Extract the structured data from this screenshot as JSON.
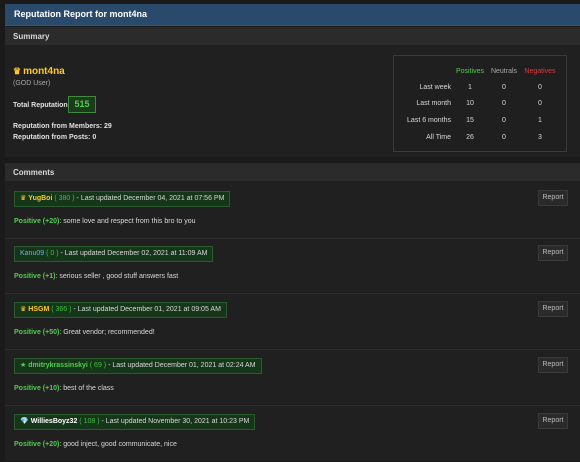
{
  "title": "Reputation Report for mont4na",
  "summary": {
    "heading": "Summary",
    "username": "mont4na",
    "usergroup": "(GOD User)",
    "total_rep_label": "Total Reputation:",
    "total_rep_value": "515",
    "rep_members": "Reputation from Members: 29",
    "rep_posts": "Reputation from Posts: 0",
    "colors": {
      "positive": "#4fcf4f",
      "neutral": "#a8a8a8",
      "negative": "#e03a3a",
      "gold": "#ffc928"
    },
    "stats": {
      "headers": [
        "Positives",
        "Neutrals",
        "Negatives"
      ],
      "rows": [
        {
          "label": "Last week",
          "pos": "1",
          "neu": "0",
          "neg": "0"
        },
        {
          "label": "Last month",
          "pos": "10",
          "neu": "0",
          "neg": "0"
        },
        {
          "label": "Last 6 months",
          "pos": "15",
          "neu": "0",
          "neg": "1"
        },
        {
          "label": "All Time",
          "pos": "26",
          "neu": "0",
          "neg": "3"
        }
      ]
    }
  },
  "comments": {
    "heading": "Comments",
    "report_label": "Report",
    "items": [
      {
        "icon": "crown-icon",
        "glyph": "♛",
        "name": "YugBoi",
        "name_color": "#ffc928",
        "score": "( 380 )",
        "meta": " - Last updated December 04, 2021 at 07:56 PM",
        "rating": "Positive (+20)",
        "text": ": some love and respect from this bro to you"
      },
      {
        "icon": "",
        "glyph": "",
        "name": "Kanu09",
        "name_color": "#6fb0d8",
        "score": "( 0 )",
        "meta": " - Last updated December 02, 2021 at 11:09 AM",
        "rating": "Positive (+1)",
        "text": ": serious seller , good stuff answers fast"
      },
      {
        "icon": "crown-icon",
        "glyph": "♛",
        "name": "HSGM",
        "name_color": "#ffc928",
        "score": "( 366 )",
        "meta": " - Last updated December 01, 2021 at 09:05 AM",
        "rating": "Positive (+50)",
        "text": ": Great vendor; recommended!"
      },
      {
        "icon": "star-icon",
        "glyph": "★",
        "name": "dmitrykrassinskyi",
        "name_color": "#4fcf4f",
        "score": "( 69 )",
        "meta": " - Last updated December 01, 2021 at 02:24 AM",
        "rating": "Positive (+10)",
        "text": ": best of the class"
      },
      {
        "icon": "diamond-icon",
        "glyph": "💎",
        "name": "WilliesBoyz32",
        "name_color": "#ffffff",
        "score": "( 108 )",
        "meta": " - Last updated November 30, 2021 at 10:23 PM",
        "rating": "Positive (+20)",
        "text": ": good inject, good communicate, nice"
      }
    ]
  }
}
